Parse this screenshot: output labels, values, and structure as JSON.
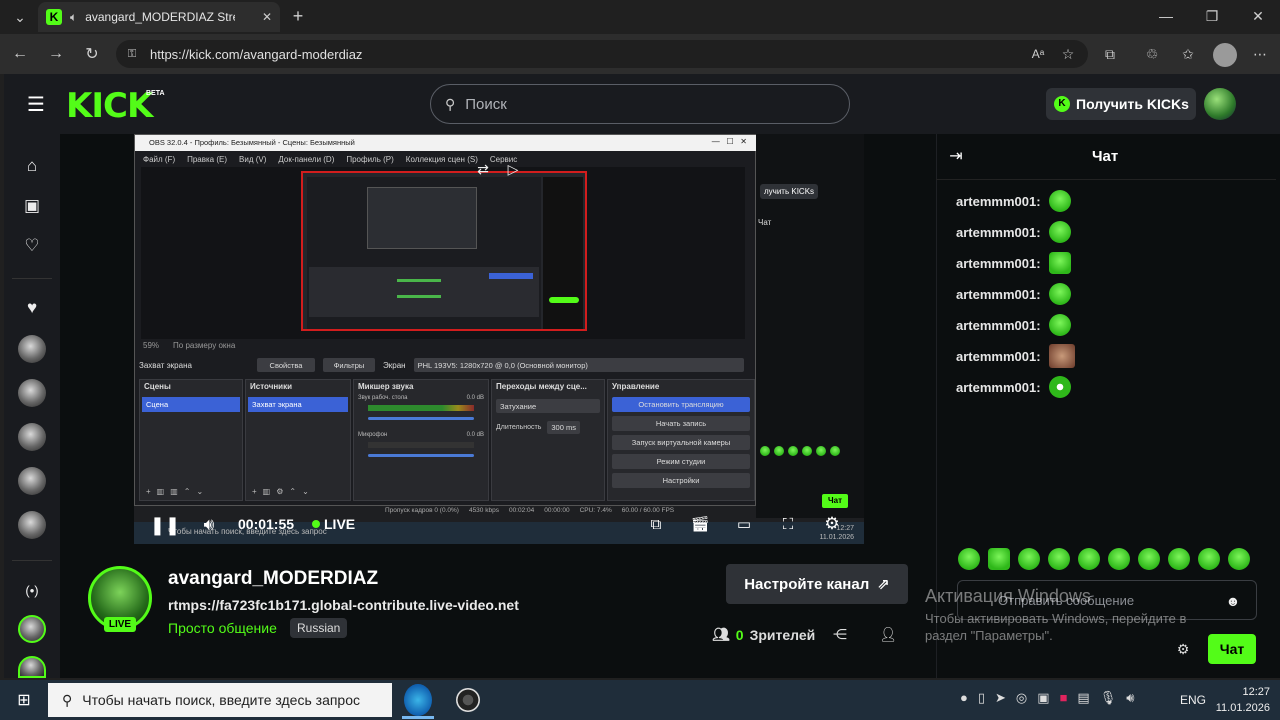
{
  "browser": {
    "tab_title": "avangard_MODERDIAZ Strea",
    "url": "https://kick.com/avangard-moderdiaz"
  },
  "site": {
    "logo": "KICK",
    "beta": "BETA",
    "search_placeholder": "Поиск",
    "get_kicks": "Получить KICKs"
  },
  "obs": {
    "window_title": "OBS 32.0.4 - Профиль: Безымянный - Сцены: Безымянный",
    "menu": [
      "Файл (F)",
      "Правка (E)",
      "Вид (V)",
      "Док-панели (D)",
      "Профиль (P)",
      "Коллекция сцен (S)",
      "Сервис"
    ],
    "zoom_label": "59%",
    "zoom_mode": "По размеру окна",
    "source_label": "Захват экрана",
    "props_btn": "Свойства",
    "filters_btn": "Фильтры",
    "screen_label": "Экран",
    "screen_value": "PHL 193V5: 1280x720 @ 0,0 (Основной монитор)",
    "docks": {
      "scenes": "Сцены",
      "sources": "Источники",
      "mixer": "Микшер звука",
      "transitions": "Переходы между сце...",
      "controls": "Управление"
    },
    "scene_item": "Сцена",
    "source_item": "Захват экрана",
    "mixer_ch1": "Звук рабоч. стола",
    "mixer_ch1_db": "0.0 dB",
    "mixer_ch2": "Микрофон",
    "mixer_ch2_db": "0.0 dB",
    "transition": "Затухание",
    "duration_label": "Длительность",
    "duration": "300 ms",
    "ctrl_buttons": [
      "Остановить трансляцию",
      "Начать запись",
      "Запуск виртуальной камеры",
      "Режим студии",
      "Настройки"
    ],
    "status": {
      "dropped": "Пропуск кадров 0 (0.0%)",
      "bitrate": "4530 kbps",
      "time1": "00:02:04",
      "time2": "00:00:00",
      "cpu": "CPU: 7.4%",
      "fps": "60.00 / 60.00 FPS"
    },
    "taskbar_search": "Чтобы начать поиск, введите здесь запрос",
    "mini_kicks": "лучить KICKs",
    "mini_chat": "Чат",
    "mini_time": "11.01.2026",
    "mini_clock": "12:27"
  },
  "player": {
    "time": "00:01:55",
    "live": "LIVE"
  },
  "stream": {
    "channel": "avangard_MODERDIAZ",
    "title": "rtmps://fa723fc1b171.global-contribute.live-video.net",
    "category": "Просто общение",
    "language": "Russian",
    "live_badge": "LIVE",
    "setup_button": "Настройте канал",
    "viewers_count": "0",
    "viewers_label": "Зрителей"
  },
  "chat": {
    "title": "Чат",
    "messages": [
      {
        "user": "artemmm001:",
        "emote": "green-smile"
      },
      {
        "user": "artemmm001:",
        "emote": "green-smile"
      },
      {
        "user": "artemmm001:",
        "emote": "green-angry"
      },
      {
        "user": "artemmm001:",
        "emote": "green-smile"
      },
      {
        "user": "artemmm001:",
        "emote": "green-smile"
      },
      {
        "user": "artemmm001:",
        "emote": "photo-face"
      },
      {
        "user": "artemmm001:",
        "emote": "green-eyes"
      }
    ],
    "input_placeholder": "Отправить сообщение",
    "send": "Чат"
  },
  "watermark": {
    "line1": "Активация Windows",
    "line2": "Чтобы активировать Windows, перейдите в",
    "line3": "раздел \"Параметры\"."
  },
  "taskbar": {
    "search": "Чтобы начать поиск, введите здесь запрос",
    "lang": "ENG",
    "time": "12:27",
    "date": "11.01.2026"
  },
  "colors": {
    "kick_green": "#53fc18",
    "bg": "#0b0e0f",
    "panel": "#191b1f",
    "obs_active": "#3b62d6"
  }
}
